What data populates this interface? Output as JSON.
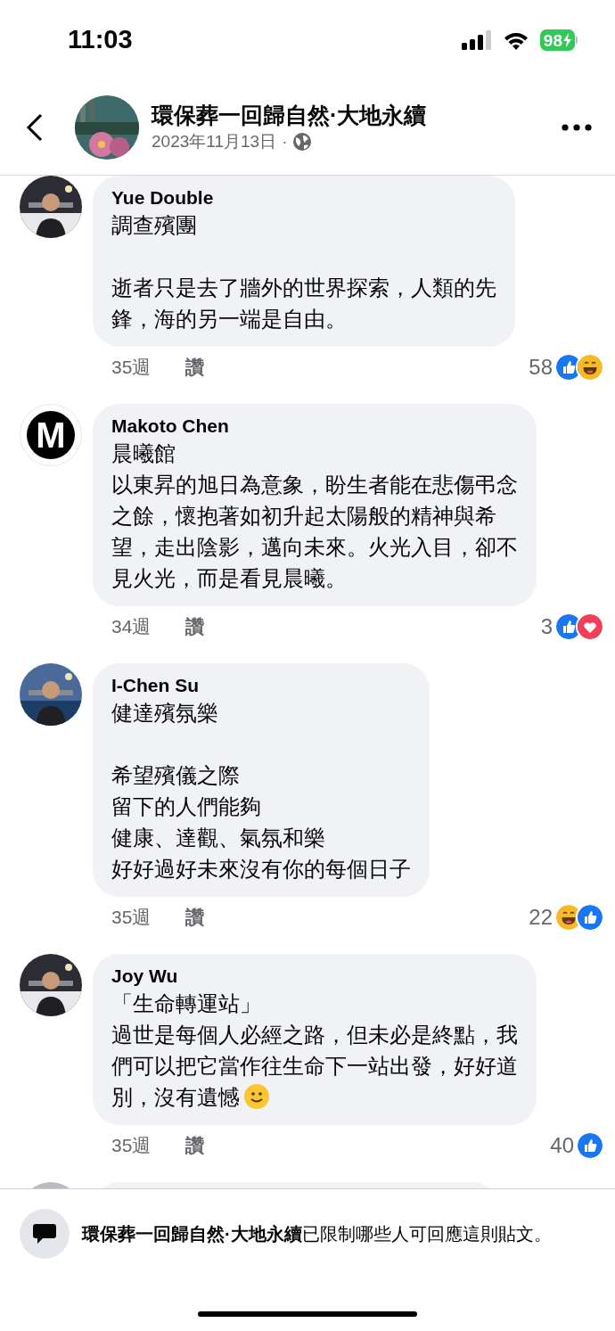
{
  "status_bar": {
    "time": "11:03",
    "battery": "98"
  },
  "header": {
    "page_name": "環保葬一回歸自然·大地永續",
    "date": "2023年11月13日",
    "separator": "·"
  },
  "comments": [
    {
      "author": "Yue Double",
      "avatar": {
        "kind": "picture"
      },
      "paragraphs": [
        [
          "調查殯團"
        ],
        [
          "逝者只是去了牆外的世界探索，人類的先",
          "鋒，海的另一端是自由。"
        ]
      ],
      "time": "35週",
      "action": "讚",
      "count": "58",
      "reactions": [
        {
          "kind": "like"
        },
        {
          "kind": "haha"
        }
      ]
    },
    {
      "author": "Makoto Chen",
      "avatar": {
        "kind": "letter",
        "letter": "M"
      },
      "paragraphs": [
        [
          "晨曦館",
          "以東昇的旭日為意象，盼生者能在悲傷弔念",
          "之餘，懷抱著如初升起太陽般的精神與希",
          "望，走出陰影，邁向未來。火光入目，卻不",
          "見火光，而是看見晨曦。"
        ]
      ],
      "time": "34週",
      "action": "讚",
      "count": "3",
      "reactions": [
        {
          "kind": "like"
        },
        {
          "kind": "love"
        }
      ]
    },
    {
      "author": "I-Chen Su",
      "avatar": {
        "kind": "picture"
      },
      "paragraphs": [
        [
          "健達殯氛樂"
        ],
        [
          "希望殯儀之際",
          "留下的人們能夠",
          "健康、達觀、氣氛和樂",
          "好好過好未來沒有你的每個日子"
        ]
      ],
      "time": "35週",
      "action": "讚",
      "count": "22",
      "reactions": [
        {
          "kind": "haha"
        },
        {
          "kind": "like"
        }
      ]
    },
    {
      "author": "Joy Wu",
      "avatar": {
        "kind": "picture"
      },
      "paragraphs": [
        [
          "「生命轉運站」",
          "過世是每個人必經之路，但未必是終點，我",
          "們可以把它當作往生命下一站出發，好好道",
          "別，沒有遺憾"
        ]
      ],
      "ends_with_emoji": true,
      "time": "35週",
      "action": "讚",
      "count": "40",
      "reactions": [
        {
          "kind": "like"
        }
      ]
    }
  ],
  "footer": {
    "notice": "**環保葬一回歸自然·大地永續**已限制哪些人可回應這則貼文。"
  }
}
